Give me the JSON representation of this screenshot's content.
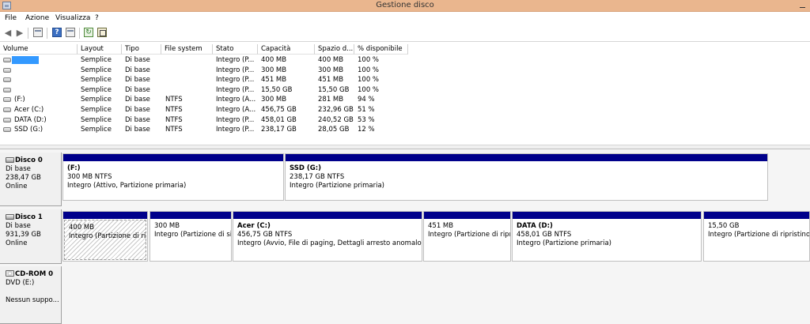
{
  "window": {
    "title": "Gestione disco"
  },
  "menu": [
    "File",
    "Azione",
    "Visualizza",
    "?"
  ],
  "toolbar": {
    "icons": [
      "back-arrow-icon",
      "forward-arrow-icon",
      "console-tree-icon",
      "help-icon",
      "action-pane-icon",
      "refresh-icon",
      "properties-icon"
    ],
    "help_glyph": "?"
  },
  "volume_table": {
    "headers": [
      "Volume",
      "Layout",
      "Tipo",
      "File system",
      "Stato",
      "Capacità",
      "Spazio d...",
      "% disponibile"
    ],
    "rows": [
      {
        "volume": "",
        "layout": "Semplice",
        "tipo": "Di base",
        "fs": "",
        "stato": "Integro (P...",
        "capacita": "400 MB",
        "spazio": "400 MB",
        "perc": "100 %"
      },
      {
        "volume": "",
        "layout": "Semplice",
        "tipo": "Di base",
        "fs": "",
        "stato": "Integro (P...",
        "capacita": "300 MB",
        "spazio": "300 MB",
        "perc": "100 %"
      },
      {
        "volume": "",
        "layout": "Semplice",
        "tipo": "Di base",
        "fs": "",
        "stato": "Integro (P...",
        "capacita": "451 MB",
        "spazio": "451 MB",
        "perc": "100 %"
      },
      {
        "volume": "",
        "layout": "Semplice",
        "tipo": "Di base",
        "fs": "",
        "stato": "Integro (P...",
        "capacita": "15,50 GB",
        "spazio": "15,50 GB",
        "perc": "100 %"
      },
      {
        "volume": "(F:)",
        "layout": "Semplice",
        "tipo": "Di base",
        "fs": "NTFS",
        "stato": "Integro (A...",
        "capacita": "300 MB",
        "spazio": "281 MB",
        "perc": "94 %"
      },
      {
        "volume": "Acer (C:)",
        "layout": "Semplice",
        "tipo": "Di base",
        "fs": "NTFS",
        "stato": "Integro (A...",
        "capacita": "456,75 GB",
        "spazio": "232,96 GB",
        "perc": "51 %"
      },
      {
        "volume": "DATA (D:)",
        "layout": "Semplice",
        "tipo": "Di base",
        "fs": "NTFS",
        "stato": "Integro (P...",
        "capacita": "458,01 GB",
        "spazio": "240,52 GB",
        "perc": "53 %"
      },
      {
        "volume": "SSD (G:)",
        "layout": "Semplice",
        "tipo": "Di base",
        "fs": "NTFS",
        "stato": "Integro (P...",
        "capacita": "238,17 GB",
        "spazio": "28,05 GB",
        "perc": "12 %"
      }
    ]
  },
  "disks": [
    {
      "name": "Disco 0",
      "type": "Di base",
      "size": "238,47 GB",
      "status": "Online",
      "partitions": [
        {
          "name": "(F:)",
          "size": "300 MB NTFS",
          "status": "Integro (Attivo, Partizione primaria)"
        },
        {
          "name": "SSD  (G:)",
          "size": "238,17 GB NTFS",
          "status": "Integro (Partizione primaria)"
        }
      ]
    },
    {
      "name": "Disco 1",
      "type": "Di base",
      "size": "931,39 GB",
      "status": "Online",
      "partitions": [
        {
          "name": "",
          "size": "400 MB",
          "status": "Integro (Partizione di ripr"
        },
        {
          "name": "",
          "size": "300 MB",
          "status": "Integro (Partizione di sis"
        },
        {
          "name": "Acer  (C:)",
          "size": "456,75 GB NTFS",
          "status": "Integro (Avvio, File di paging, Dettagli arresto anomalo del"
        },
        {
          "name": "",
          "size": "451 MB",
          "status": "Integro (Partizione di ripri"
        },
        {
          "name": "DATA  (D:)",
          "size": "458,01 GB NTFS",
          "status": "Integro (Partizione primaria)"
        },
        {
          "name": "",
          "size": "15,50 GB",
          "status": "Integro (Partizione di ripristino)"
        }
      ]
    },
    {
      "name": "CD-ROM 0",
      "type": "DVD (E:)",
      "size": "",
      "status": "Nessun suppo..."
    }
  ],
  "colors": {
    "titlebar": "#eab68e",
    "partition_bar": "#00008b",
    "selection": "#3399ff"
  }
}
